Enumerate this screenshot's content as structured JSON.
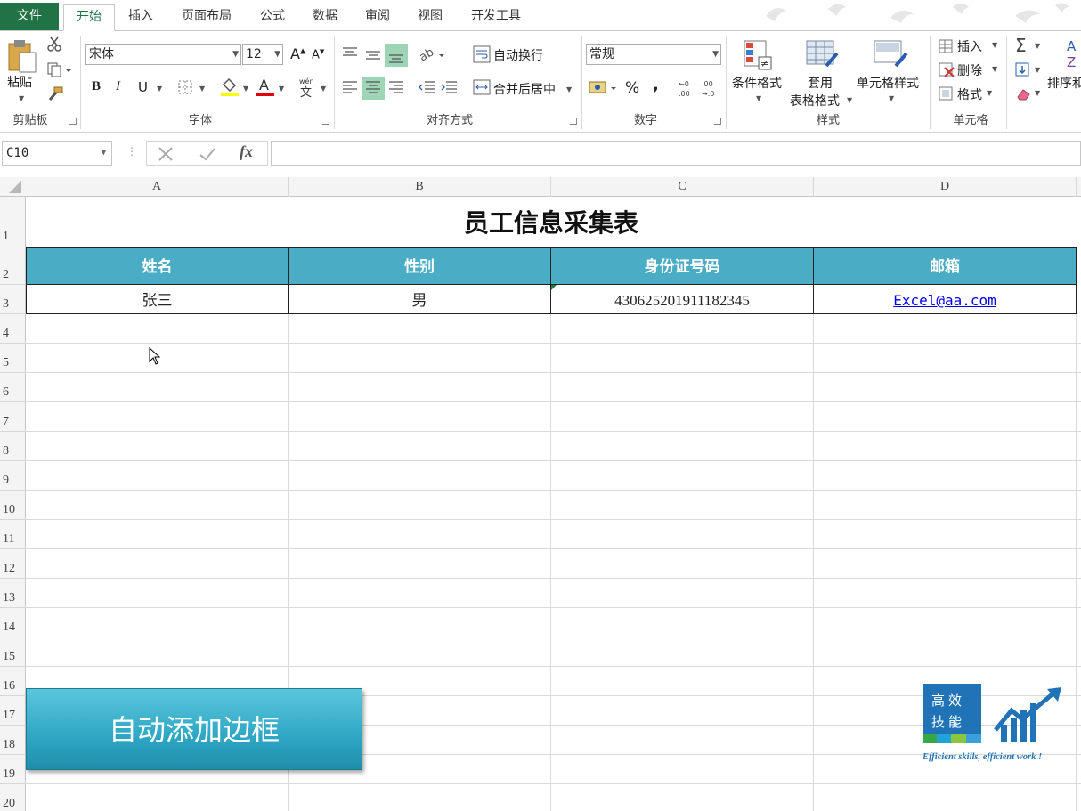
{
  "tabs": [
    {
      "label": "文件",
      "type": "file"
    },
    {
      "label": "开始",
      "type": "active"
    },
    {
      "label": "插入"
    },
    {
      "label": "页面布局"
    },
    {
      "label": "公式"
    },
    {
      "label": "数据"
    },
    {
      "label": "审阅"
    },
    {
      "label": "视图"
    },
    {
      "label": "开发工具"
    }
  ],
  "ribbon": {
    "clipboard": {
      "paste": "粘贴",
      "label": "剪贴板"
    },
    "font": {
      "name": "宋体",
      "size": "12",
      "label": "字体",
      "bold": "B",
      "italic": "I",
      "underline": "U"
    },
    "alignment": {
      "wrap": "自动换行",
      "merge": "合并后居中",
      "label": "对齐方式"
    },
    "number": {
      "format": "常规",
      "percent": "%",
      "comma": ",",
      "label": "数字"
    },
    "styles": {
      "cond": "条件格式",
      "table1": "套用",
      "table2": "表格格式",
      "cell": "单元格样式",
      "label": "样式"
    },
    "cells": {
      "insert": "插入",
      "delete": "删除",
      "format": "格式",
      "label": "单元格"
    },
    "editing": {
      "sort": "排序和"
    }
  },
  "formula_bar": {
    "name_box": "C10",
    "fx": "fx",
    "value": ""
  },
  "columns": [
    "A",
    "B",
    "C",
    "D"
  ],
  "rows": [
    "1",
    "2",
    "3",
    "4",
    "5",
    "6",
    "7",
    "8",
    "9",
    "10",
    "11",
    "12",
    "13",
    "14",
    "15",
    "16",
    "17",
    "18",
    "19",
    "20"
  ],
  "sheet": {
    "title": "员工信息采集表",
    "headers": [
      "姓名",
      "性别",
      "身份证号码",
      "邮箱"
    ],
    "row": [
      "张三",
      "男",
      "430625201911182345",
      "Excel@aa.com"
    ]
  },
  "overlay": {
    "banner": "自动添加边框",
    "logo_line1": "高效",
    "logo_line2": "技能",
    "logo_slogan": "Efficient skills, efficient work !"
  },
  "colors": {
    "accent": "#217346",
    "header_fill": "#4bacc6",
    "banner": "#2ea7c4",
    "logo_blue": "#1f73b6"
  }
}
